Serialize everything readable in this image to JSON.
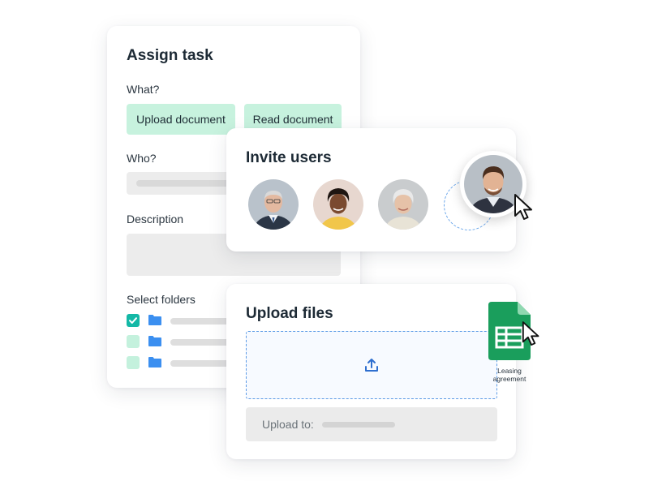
{
  "assign_task": {
    "title": "Assign task",
    "what_label": "What?",
    "options": [
      "Upload document",
      "Read document"
    ],
    "who_label": "Who?",
    "description_label": "Description",
    "folders_label": "Select folders",
    "folders_checked": [
      true,
      false,
      false
    ]
  },
  "invite_users": {
    "title": "Invite users"
  },
  "upload_files": {
    "title": "Upload files",
    "upload_to_label": "Upload to:"
  },
  "dragged_file": {
    "name": "Leasing agreement",
    "icon": "spreadsheet-icon"
  },
  "colors": {
    "chip": "#c7f2de",
    "checkbox_checked": "#14b8a6",
    "folder": "#3b8ff0",
    "dropzone_border": "#5c9be6",
    "sheets_green": "#1a9e5c"
  }
}
